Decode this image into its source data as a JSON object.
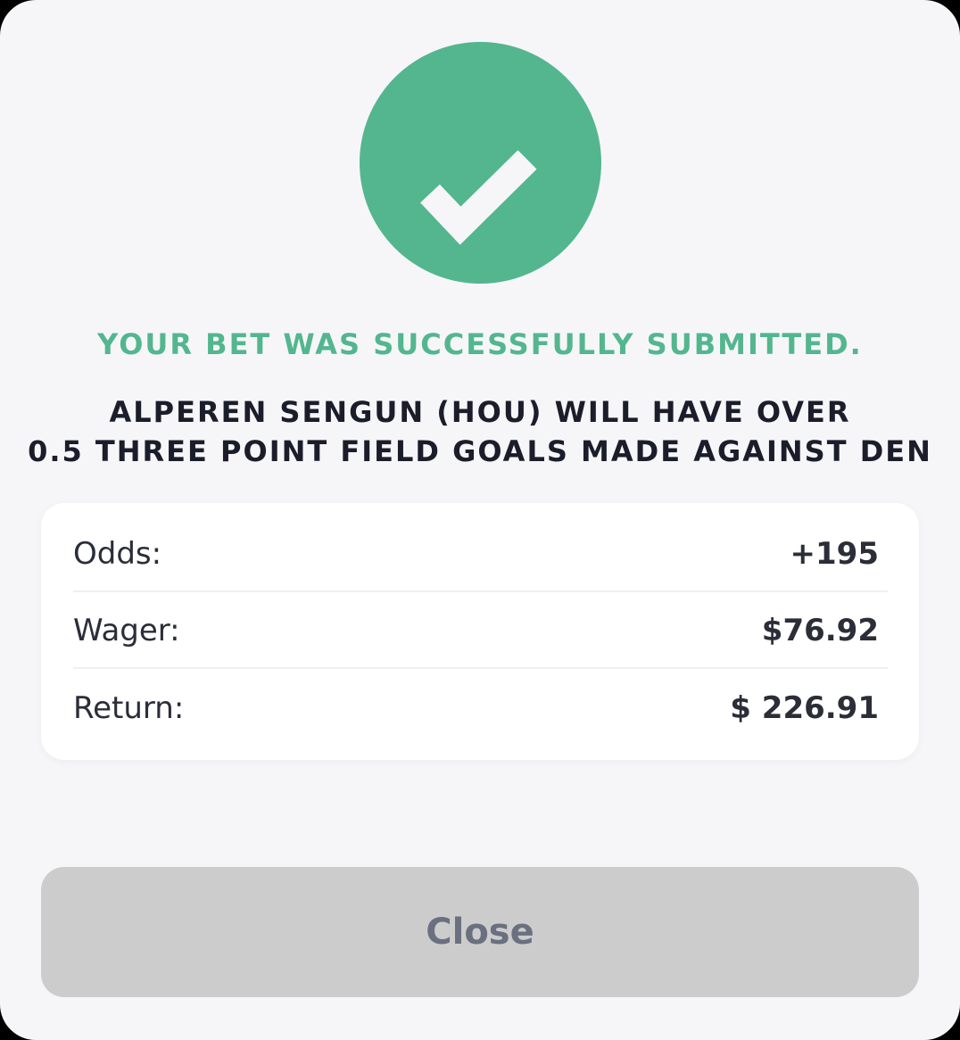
{
  "status": {
    "icon": "check-icon",
    "message": "YOUR BET WAS SUCCESSFULLY SUBMITTED."
  },
  "bet": {
    "description_lines": [
      "ALPEREN SENGUN (HOU) WILL HAVE OVER",
      "0.5 THREE POINT FIELD GOALS MADE AGAINST DEN"
    ]
  },
  "summary": {
    "rows": [
      {
        "label": "Odds:",
        "value": "+195"
      },
      {
        "label": "Wager:",
        "value": "$76.92"
      },
      {
        "label": "Return:",
        "value": "$ 226.91"
      }
    ]
  },
  "actions": {
    "close_label": "Close"
  },
  "colors": {
    "success": "#53b68f",
    "background": "#f6f6f8",
    "card": "#ffffff",
    "button": "#cccccc",
    "button_text": "#6b7080",
    "text": "#1b1d2b"
  }
}
